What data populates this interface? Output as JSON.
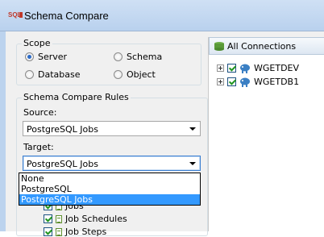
{
  "window": {
    "title": "Schema Compare",
    "app_icon": "sql-icon"
  },
  "scope": {
    "legend": "Scope",
    "options": [
      {
        "label": "Server",
        "selected": true
      },
      {
        "label": "Schema",
        "selected": false
      },
      {
        "label": "Database",
        "selected": false
      },
      {
        "label": "Object",
        "selected": false
      }
    ]
  },
  "rules": {
    "legend": "Schema Compare Rules",
    "source_label": "Source:",
    "source_value": "PostgreSQL Jobs",
    "target_label": "Target:",
    "target_value": "PostgreSQL Jobs",
    "dropdown_options": [
      "None",
      "PostgreSQL",
      "PostgreSQL Jobs"
    ],
    "dropdown_selected_index": 2,
    "list_items": [
      {
        "label": "Jobs",
        "checked": true
      },
      {
        "label": "Job Schedules",
        "checked": true
      },
      {
        "label": "Job Steps",
        "checked": true
      }
    ]
  },
  "connections": {
    "header": "All Connections",
    "items": [
      {
        "label": "WGETDEV",
        "checked": true
      },
      {
        "label": "WGETDB1",
        "checked": true
      }
    ]
  },
  "colors": {
    "selection": "#3399ff",
    "title_bar": "#c4d9f1",
    "checkmark": "#219521"
  }
}
